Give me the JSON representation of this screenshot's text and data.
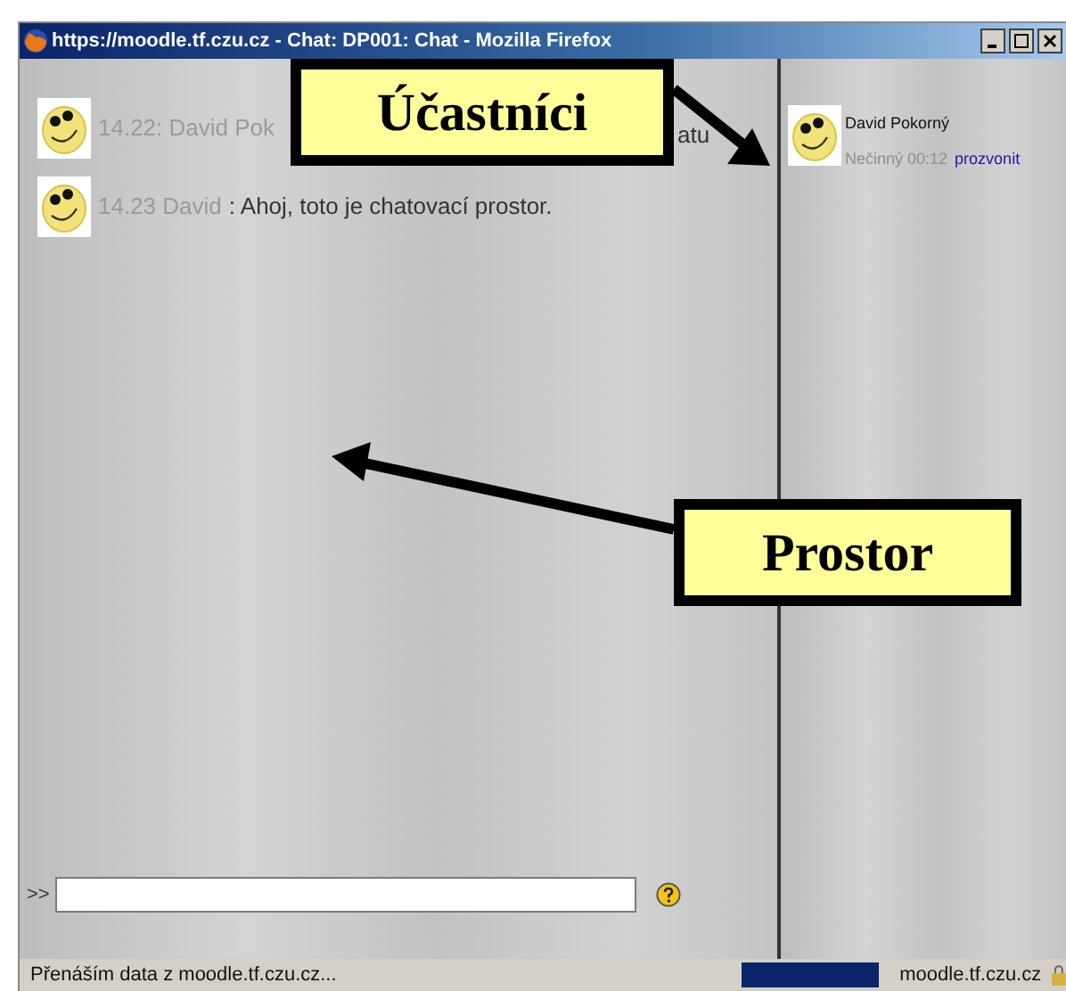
{
  "window": {
    "title": "https://moodle.tf.czu.cz - Chat: DP001: Chat - Mozilla Firefox"
  },
  "messages": [
    {
      "time_author": "14.22: David Pok",
      "text": "atu"
    },
    {
      "time_author": "14.23 David",
      "text": ": Ahoj, toto je chatovací prostor."
    }
  ],
  "input": {
    "prompt": ">>"
  },
  "participants": [
    {
      "name": "David Pokorný",
      "idle": "Nečinný 00:12",
      "link": "prozvonit"
    }
  ],
  "callouts": [
    {
      "label": "Účastníci"
    },
    {
      "label": "Prostor"
    }
  ],
  "status_bar": {
    "message": "Přenáším data z moodle.tf.czu.cz...",
    "host": "moodle.tf.czu.cz"
  }
}
